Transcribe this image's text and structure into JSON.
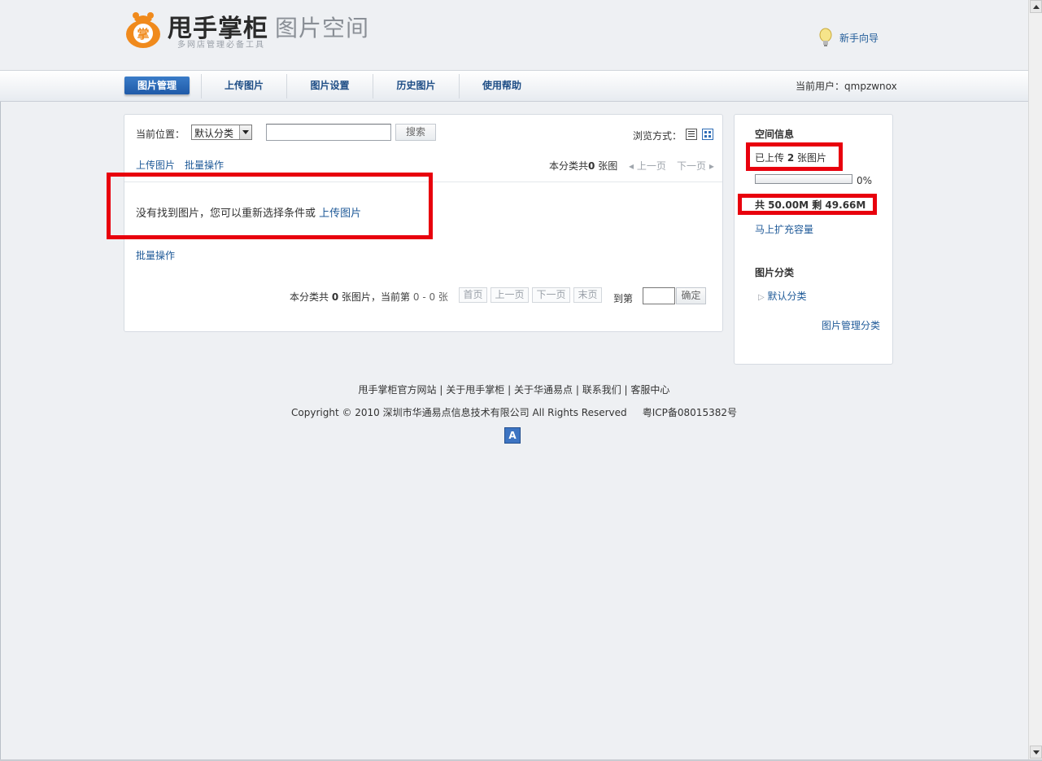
{
  "header": {
    "logo_badge_char": "掌",
    "logo_title": "甩手掌柜",
    "logo_subtitle": "图片空间",
    "logo_tagline": "多网店管理必备工具",
    "guide_label": "新手向导"
  },
  "nav": {
    "items": [
      {
        "label": "图片管理",
        "active": true
      },
      {
        "label": "上传图片",
        "active": false
      },
      {
        "label": "图片设置",
        "active": false
      },
      {
        "label": "历史图片",
        "active": false
      },
      {
        "label": "使用帮助",
        "active": false
      }
    ],
    "current_user_label": "当前用户：",
    "current_user": "qmpzwnox"
  },
  "main": {
    "location_label": "当前位置：",
    "category_selected": "默认分类",
    "search_value": "",
    "search_button": "搜索",
    "view_mode_label": "浏览方式：",
    "upload_link": "上传图片",
    "batch_link": "批量操作",
    "category_count_text": "本分类共",
    "category_count_value": "0",
    "category_count_unit": "张图",
    "prev_page": "上一页",
    "next_page": "下一页",
    "empty_message": "没有找到图片，您可以重新选择条件或",
    "empty_upload_link": "上传图片",
    "batch_link_bottom": "批量操作",
    "pager": {
      "total_prefix": "本分类共",
      "total_value": "0",
      "total_suffix": "张图片，当前第",
      "range": "0 - 0 张",
      "first": "首页",
      "prev": "上一页",
      "next": "下一页",
      "last": "末页",
      "goto_label": "到第",
      "goto_value": "",
      "confirm": "确定"
    }
  },
  "side": {
    "space_title": "空间信息",
    "uploaded_prefix": "已上传",
    "uploaded_count": "2",
    "uploaded_suffix": "张图片",
    "usage_percent_text": "0%",
    "usage_fraction": 0.0,
    "capacity_text": "共 50.00M  剩 49.66M",
    "expand_link": "马上扩充容量",
    "category_title": "图片分类",
    "category_item": "默认分类",
    "manage_link": "图片管理分类"
  },
  "footer": {
    "links": [
      "甩手掌柜官方网站",
      "关于甩手掌柜",
      "关于华通易点",
      "联系我们",
      "客服中心"
    ],
    "separator": "|",
    "copyright": "Copyright © 2010 深圳市华通易点信息技术有限公司  All Rights Reserved",
    "icp": "粤ICP备08015382号",
    "badge_char": "A"
  },
  "colors": {
    "accent": "#1f5a98",
    "highlight_red": "#e8000d",
    "logo_orange": "#f08a1c"
  }
}
